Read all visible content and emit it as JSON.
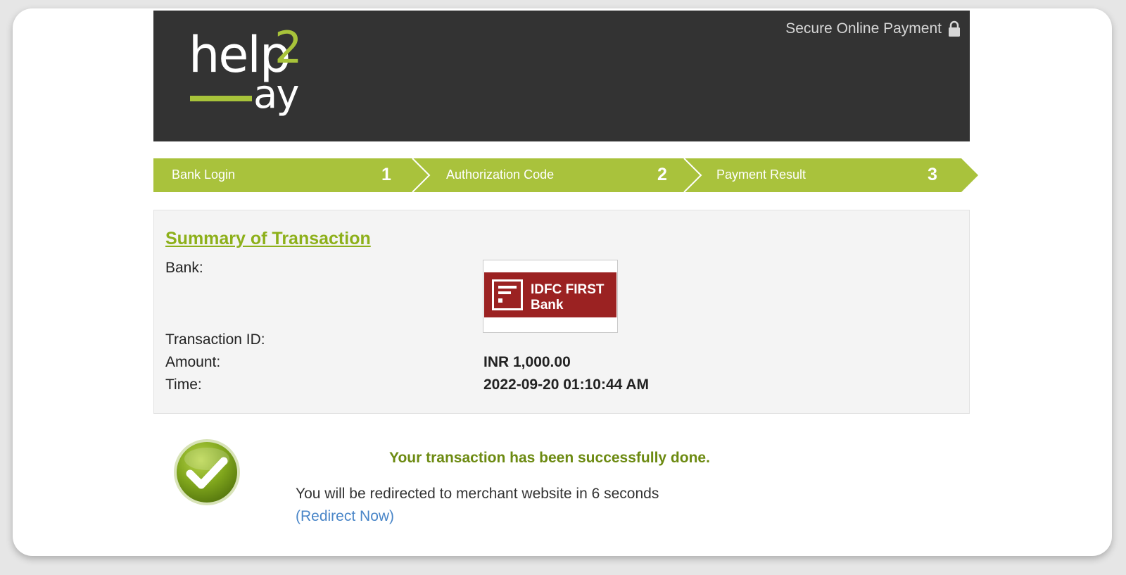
{
  "header": {
    "logo": {
      "text_main": "help",
      "text_digit": "2",
      "text_sub": "ay"
    },
    "secure_label": "Secure Online Payment",
    "secure_icon": "lock-icon"
  },
  "steps": [
    {
      "label": "Bank Login",
      "number": "1"
    },
    {
      "label": "Authorization Code",
      "number": "2"
    },
    {
      "label": "Payment Result",
      "number": "3"
    }
  ],
  "summary": {
    "title": "Summary of Transaction",
    "bank_label": "Bank:",
    "bank_logo": {
      "line1": "IDFC FIRST",
      "line2": "Bank"
    },
    "transaction_id_label": "Transaction ID:",
    "transaction_id_value": "",
    "amount_label": "Amount:",
    "amount_value": "INR 1,000.00",
    "time_label": "Time:",
    "time_value": "2022-09-20 01:10:44 AM"
  },
  "result": {
    "icon": "checkmark-icon",
    "success_message": "Your transaction has been successfully done.",
    "redirect_message": "You will be redirected to merchant website in 6 seconds",
    "redirect_link": "(Redirect Now)"
  },
  "colors": {
    "accent_green": "#a9c23c",
    "header_bg": "#333333",
    "bank_red": "#9b2222",
    "link_blue": "#4a86c8"
  }
}
